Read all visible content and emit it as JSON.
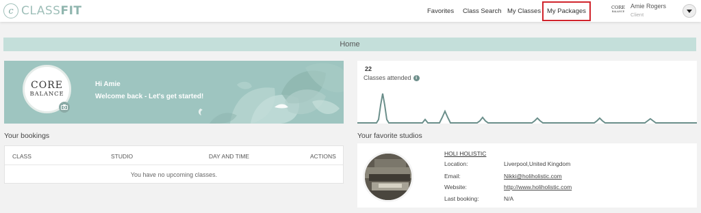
{
  "app": {
    "logo_letter": "c",
    "name_light": "CLASS",
    "name_bold": "FIT"
  },
  "nav": {
    "favorites": "Favorites",
    "class_search": "Class Search",
    "my_classes": "My Classes",
    "my_packages": "My Packages"
  },
  "user": {
    "studio_logo_l1": "CORE",
    "studio_logo_l2": "BALANCE",
    "name": "Amie Rogers",
    "role": "Client"
  },
  "page": {
    "title": "Home"
  },
  "welcome": {
    "logo_line1": "CORE",
    "logo_line2": "BALANCE",
    "greeting": "Hi Amie",
    "message": "Welcome back - Let's get started!"
  },
  "stats": {
    "count": "22",
    "label": "Classes attended"
  },
  "bookings": {
    "title": "Your bookings",
    "columns": [
      "CLASS",
      "STUDIO",
      "DAY AND TIME",
      "ACTIONS"
    ],
    "empty": "You have no upcoming classes."
  },
  "favorites": {
    "title": "Your favorite studios",
    "studio": {
      "name": "HOLI HOLISTIC",
      "fields": [
        {
          "label": "Location:",
          "value": "Liverpool,United Kingdom"
        },
        {
          "label": "Email:",
          "value": "Nikki@holiholistic.com"
        },
        {
          "label": "Website:",
          "value": "http://www.holiholistic.com"
        },
        {
          "label": "Last booking:",
          "value": "N/A"
        }
      ]
    }
  },
  "colors": {
    "accent": "#9ec5c0",
    "strip": "#c4dfda",
    "highlight": "#d0232b",
    "sparkline": "#6a8e8a"
  }
}
